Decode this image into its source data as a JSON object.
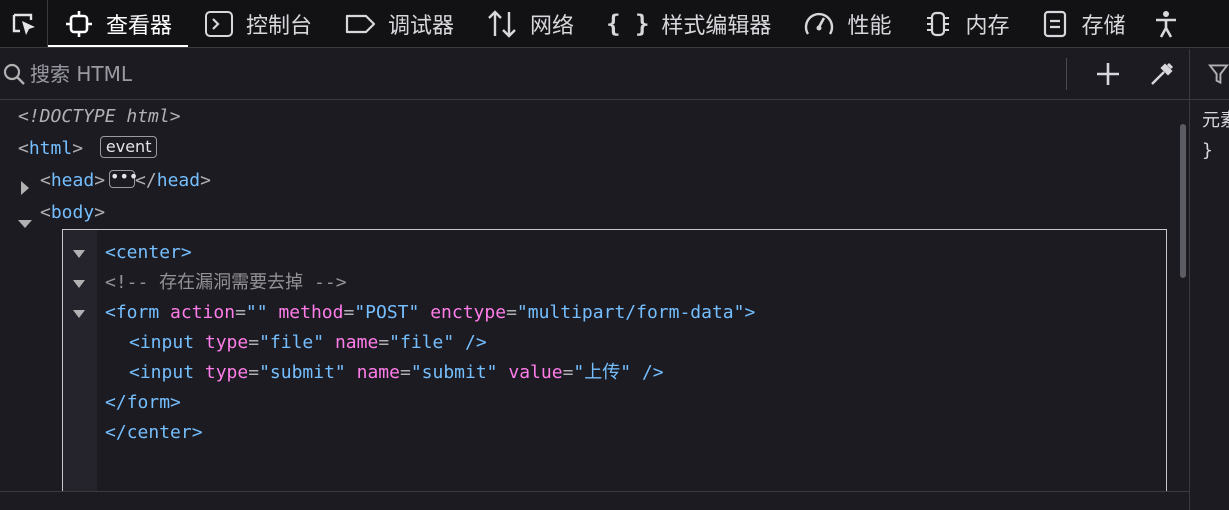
{
  "toolbar": {
    "tabs": [
      {
        "label": "查看器",
        "icon": "inspector-icon",
        "selected": true
      },
      {
        "label": "控制台",
        "icon": "console-icon"
      },
      {
        "label": "调试器",
        "icon": "debugger-icon"
      },
      {
        "label": "网络",
        "icon": "network-icon"
      },
      {
        "label": "样式编辑器",
        "icon": "style-editor-icon"
      },
      {
        "label": "性能",
        "icon": "performance-icon"
      },
      {
        "label": "内存",
        "icon": "memory-icon"
      },
      {
        "label": "存储",
        "icon": "storage-icon"
      }
    ]
  },
  "search": {
    "placeholder": "搜索 HTML"
  },
  "rules": {
    "line1": "元素",
    "line2": "}"
  },
  "tree": {
    "doctype": "<!DOCTYPE html>",
    "html_open": "<",
    "html_tag": "html",
    "html_close": ">",
    "event_badge": "event",
    "head_tag": "head",
    "body_tag": "body"
  },
  "code": {
    "center_open": "center",
    "comment": "<!-- 存在漏洞需要去掉  -->",
    "form_tag": "form",
    "form_action_name": "action",
    "form_action_val": "\"\"",
    "form_method_name": "method",
    "form_method_val": "\"POST\"",
    "form_enctype_name": "enctype",
    "form_enctype_val": "\"multipart/form-data\"",
    "input_tag": "input",
    "input1_type_name": "type",
    "input1_type_val": "\"file\"",
    "input1_name_name": "name",
    "input1_name_val": "\"file\"",
    "input2_type_name": "type",
    "input2_type_val": "\"submit\"",
    "input2_name_name": "name",
    "input2_name_val": "\"submit\"",
    "input2_value_name": "value",
    "input2_value_val": "\"上传\"",
    "form_close": "form",
    "center_close": "center"
  },
  "colors": {
    "accent_tag": "#75bfff",
    "attribute": "#ff7de9",
    "comment": "#939395",
    "background": "#1c1b22"
  }
}
